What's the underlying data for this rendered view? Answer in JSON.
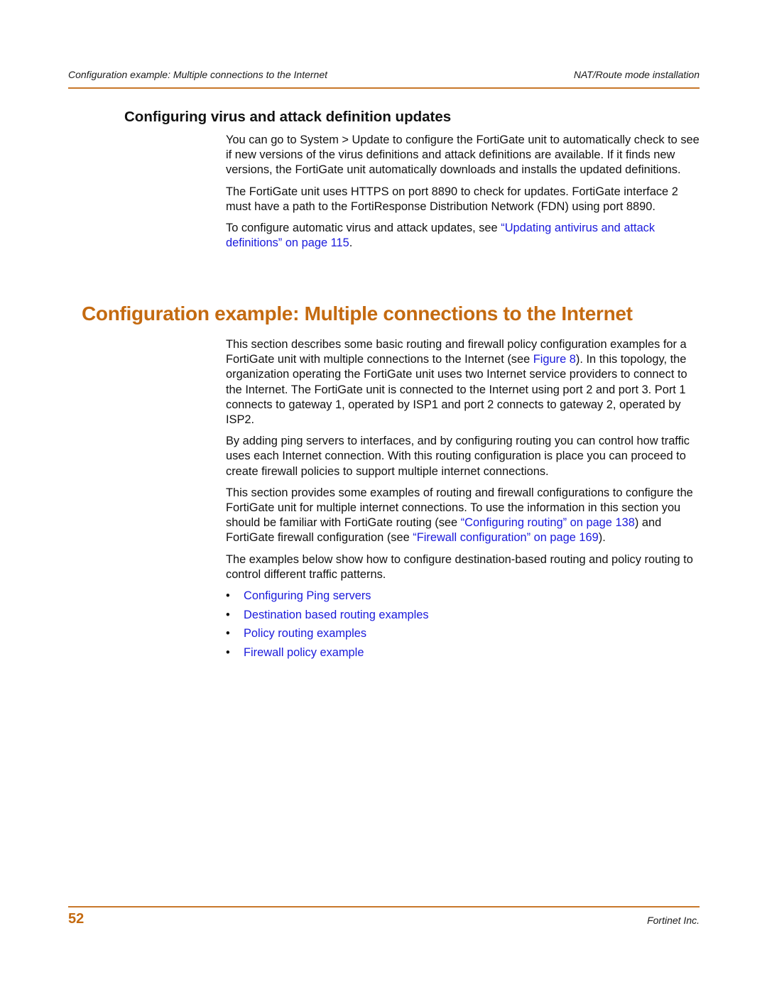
{
  "header": {
    "left": "Configuration example: Multiple connections to the Internet",
    "right": "NAT/Route mode installation"
  },
  "section1": {
    "heading": "Configuring virus and attack definition updates",
    "p1": "You can go to System > Update to configure the FortiGate unit to automatically check to see if new versions of the virus definitions and attack definitions are available. If it finds new versions, the FortiGate unit automatically downloads and installs the updated definitions.",
    "p2": "The FortiGate unit uses HTTPS on port 8890 to check for updates. FortiGate interface 2 must have a path to the FortiResponse Distribution Network (FDN) using port 8890.",
    "p3_before": "To configure automatic virus and attack updates, see ",
    "p3_link": "“Updating antivirus and attack definitions” on page 115",
    "p3_after": "."
  },
  "section2": {
    "heading": "Configuration example: Multiple connections to the Internet",
    "p1_before": "This section describes some basic routing and firewall policy configuration examples for a FortiGate unit with multiple connections to the Internet (see ",
    "p1_link": "Figure 8",
    "p1_after": "). In this topology, the organization operating the FortiGate unit uses two Internet service providers to connect to the Internet. The FortiGate unit is connected to the Internet using port 2 and port 3. Port 1 connects to gateway 1, operated by ISP1 and port 2 connects to gateway 2, operated by ISP2.",
    "p2": "By adding ping servers to interfaces, and by configuring routing you can control how traffic uses each Internet connection. With this routing configuration is place you can proceed to create firewall policies to support multiple internet connections.",
    "p3_before": "This section provides some examples of routing and firewall configurations to configure the FortiGate unit for multiple internet connections. To use the information in this section you should be familiar with FortiGate routing (see ",
    "p3_link1": "“Configuring routing” on page 138",
    "p3_mid": ") and FortiGate firewall configuration (see ",
    "p3_link2": "“Firewall configuration” on page 169",
    "p3_after": ").",
    "p4": "The examples below show how to configure destination-based routing and policy routing to control different traffic patterns.",
    "bullet_glyph": "•",
    "bullets": [
      "Configuring Ping servers",
      "Destination based routing examples",
      "Policy routing examples",
      "Firewall policy example"
    ]
  },
  "footer": {
    "page_number": "52",
    "company": "Fortinet Inc."
  },
  "colors": {
    "accent": "#c46a10",
    "rule": "#c8782a",
    "link": "#1a1adc"
  }
}
